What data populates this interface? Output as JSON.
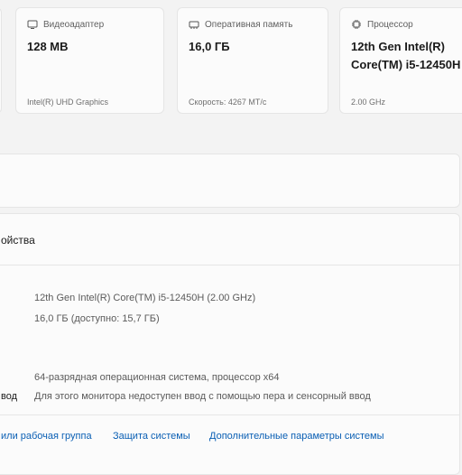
{
  "cards": [
    {
      "title": "Видеоадаптер",
      "value": "128 MB",
      "value2": "",
      "sub": "Intel(R) UHD Graphics",
      "icon": "display-adapter-icon"
    },
    {
      "title": "Оперативная память",
      "value": "16,0 ГБ",
      "value2": "",
      "sub": "Скорость: 4267 MT/c",
      "icon": "ram-icon"
    },
    {
      "title": "Процессор",
      "value": "12th Gen Intel(R)",
      "value2": "Core(TM) i5-12450H",
      "sub": "2.00 GHz",
      "icon": "processor-icon"
    }
  ],
  "specs": {
    "title": "ойства",
    "rows": [
      {
        "label": "",
        "value": "12th Gen Intel(R) Core(TM) i5-12450H (2.00 GHz)"
      },
      {
        "label": "",
        "value": "16,0 ГБ (доступно: 15,7 ГБ)"
      },
      {
        "label": "",
        "value": "64-разрядная операционная система, процессор x64"
      },
      {
        "label": "вод",
        "value": "Для этого монитора недоступен ввод с помощью пера и сенсорный ввод"
      }
    ],
    "links": [
      "или рабочая группа",
      "Защита системы",
      "Дополнительные параметры системы"
    ]
  }
}
